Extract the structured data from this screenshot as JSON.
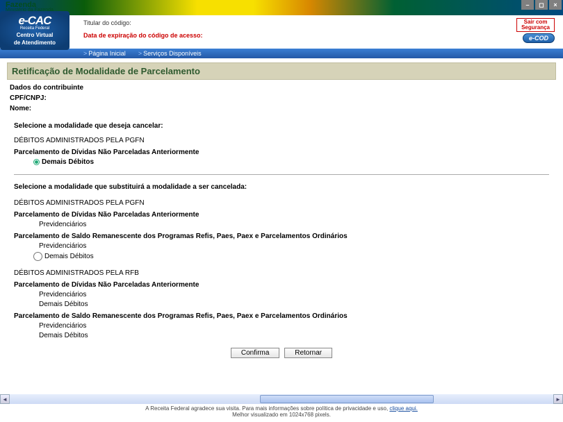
{
  "topbar": {
    "brand": "Fazenda",
    "sub": "Ministério da Fazenda"
  },
  "header": {
    "cac_e": "e-CAC",
    "cac_rf": "Receita Federal",
    "cac_cv1": "Centro Virtual",
    "cac_cv2": "de Atendimento",
    "titular_label": "Titular do código:",
    "expira": "Data de expiração do código de acesso:",
    "sair1": "Sair com",
    "sair2": "Segurança",
    "ecod": "e-COD"
  },
  "nav": {
    "home": "Página Inicial",
    "serv": "Serviços Disponíveis"
  },
  "page": {
    "title": "Retificação de Modalidade de Parcelamento",
    "dados": "Dados do contribuinte",
    "cpf": "CPF/CNPJ:",
    "nome": "Nome:",
    "sel_cancel": "Selecione a modalidade que deseja cancelar:",
    "pgfn": "DÉBITOS ADMINISTRADOS PELA PGFN",
    "rfb": "DÉBITOS ADMINISTRADOS PELA RFB",
    "parc_nao": "Parcelamento de Dívidas Não Parceladas Anteriormente",
    "parc_saldo": "Parcelamento de Saldo Remanescente dos Programas Refis, Paes, Paex e Parcelamentos Ordinários",
    "demais": "Demais Débitos",
    "prev": "Previdenciários",
    "sel_subst": "Selecione a modalidade que substituirá a modalidade a ser cancelada:",
    "confirma": "Confirma",
    "retornar": "Retornar"
  },
  "footer": {
    "line1a": "A Receita Federal agradece sua visita. Para mais informações sobre política de privacidade e uso, ",
    "link": "clique aqui.",
    "line2": "Melhor visualizado em 1024x768 pixels."
  }
}
